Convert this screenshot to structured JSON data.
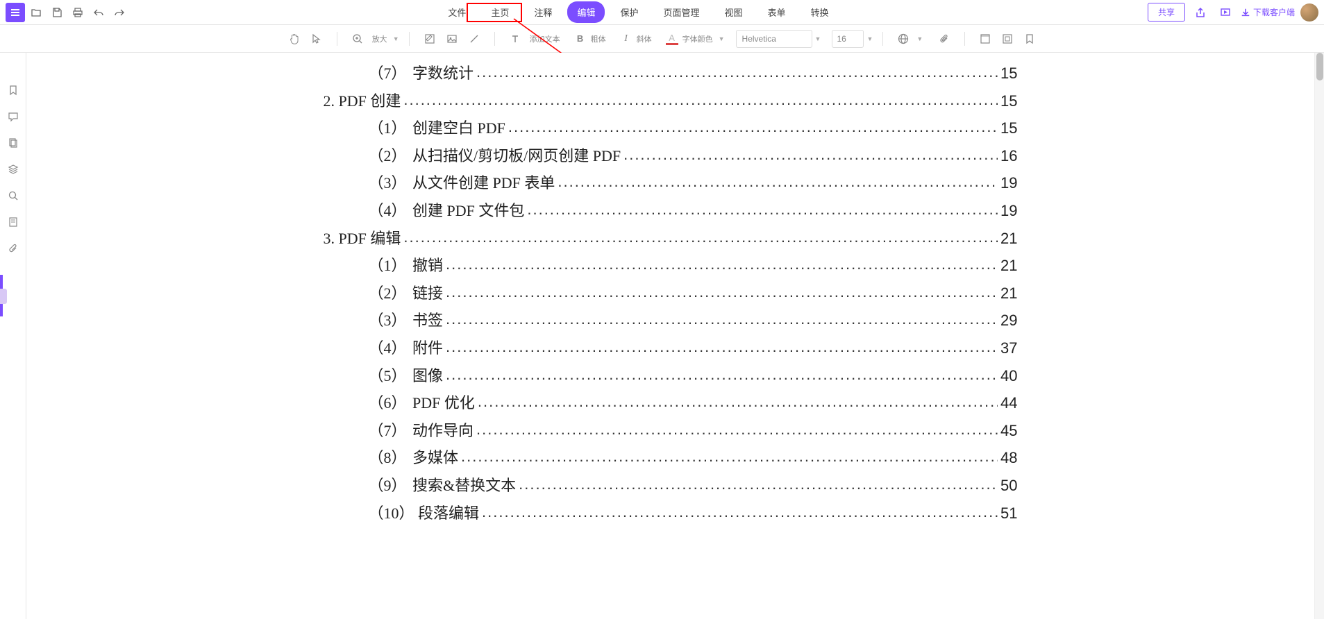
{
  "topbar": {
    "menus": [
      {
        "label": "文件"
      },
      {
        "label": "主页"
      },
      {
        "label": "注释"
      },
      {
        "label": "编辑",
        "active": true
      },
      {
        "label": "保护"
      },
      {
        "label": "页面管理"
      },
      {
        "label": "视图"
      },
      {
        "label": "表单"
      },
      {
        "label": "转换"
      }
    ],
    "share": "共享",
    "download": "下载客户端"
  },
  "toolbar": {
    "zoom_label": "放大",
    "add_text": "添加文本",
    "bold_label": "粗体",
    "italic_label": "斜体",
    "font_color": "字体颜色",
    "font_name": "Helvetica",
    "font_size": "16"
  },
  "toc": [
    {
      "level": 2,
      "num": "（7）",
      "title": "字数统计",
      "page": "15"
    },
    {
      "level": 1,
      "num": "2.",
      "title": "PDF 创建",
      "page": "15"
    },
    {
      "level": 2,
      "num": "（1）",
      "title": "创建空白 PDF",
      "page": "15"
    },
    {
      "level": 2,
      "num": "（2）",
      "title": "从扫描仪/剪切板/网页创建 PDF",
      "page": "16"
    },
    {
      "level": 2,
      "num": "（3）",
      "title": "从文件创建 PDF 表单",
      "page": "19"
    },
    {
      "level": 2,
      "num": "（4）",
      "title": "创建 PDF 文件包",
      "page": "19"
    },
    {
      "level": 1,
      "num": "3.",
      "title": "PDF 编辑",
      "page": "21"
    },
    {
      "level": 2,
      "num": "（1）",
      "title": "撤销",
      "page": "21"
    },
    {
      "level": 2,
      "num": "（2）",
      "title": "链接",
      "page": "21"
    },
    {
      "level": 2,
      "num": "（3）",
      "title": "书签",
      "page": "29"
    },
    {
      "level": 2,
      "num": "（4）",
      "title": "附件",
      "page": "37"
    },
    {
      "level": 2,
      "num": "（5）",
      "title": "图像",
      "page": "40"
    },
    {
      "level": 2,
      "num": "（6）",
      "title": "PDF 优化",
      "page": "44"
    },
    {
      "level": 2,
      "num": "（7）",
      "title": "动作导向",
      "page": "45"
    },
    {
      "level": 2,
      "num": "（8）",
      "title": "多媒体",
      "page": "48"
    },
    {
      "level": 2,
      "num": "（9）",
      "title": "搜索&替换文本",
      "page": "50"
    },
    {
      "level": 2,
      "num": "（10）",
      "title": "段落编辑",
      "page": "51"
    }
  ]
}
